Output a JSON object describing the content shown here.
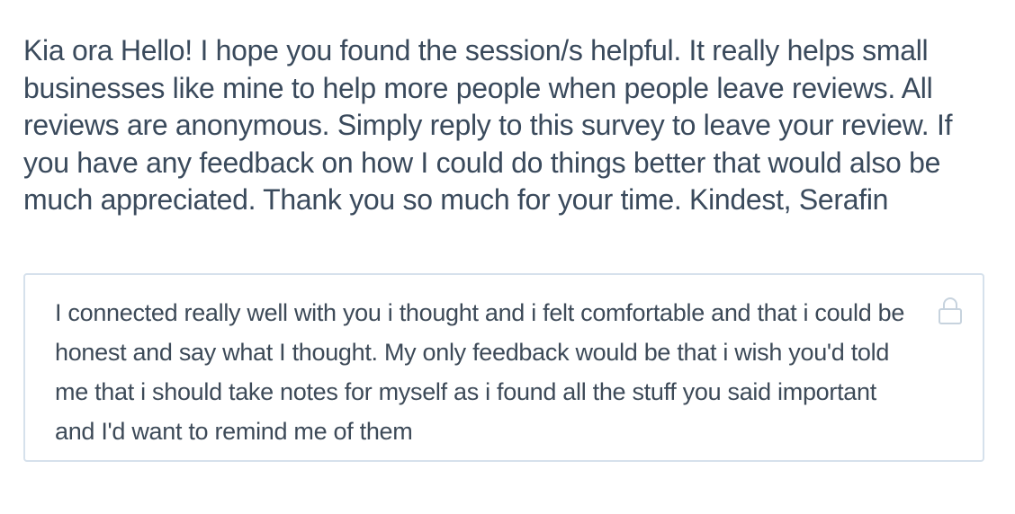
{
  "survey": {
    "question": "Kia ora Hello! I hope you found the session/s helpful. It really helps small businesses like mine to help more people when people leave reviews. All reviews are anonymous. Simply reply to this survey to leave your review. If you have any feedback on how I could do things better that would also be much appreciated. Thank you so much for your time. Kindest, Serafin",
    "response": "I connected really well with you i thought and i felt comfortable and that i could be honest and say what I thought. My only feedback would be that i wish you'd told me that i should take notes for myself as i found all the stuff you said important and I'd want to remind me of them",
    "lock_icon": "lock-icon"
  },
  "colors": {
    "question_text": "#3a4a5c",
    "response_text": "#3d4a58",
    "box_border": "#d6e1ec",
    "lock": "#c7d3de"
  }
}
